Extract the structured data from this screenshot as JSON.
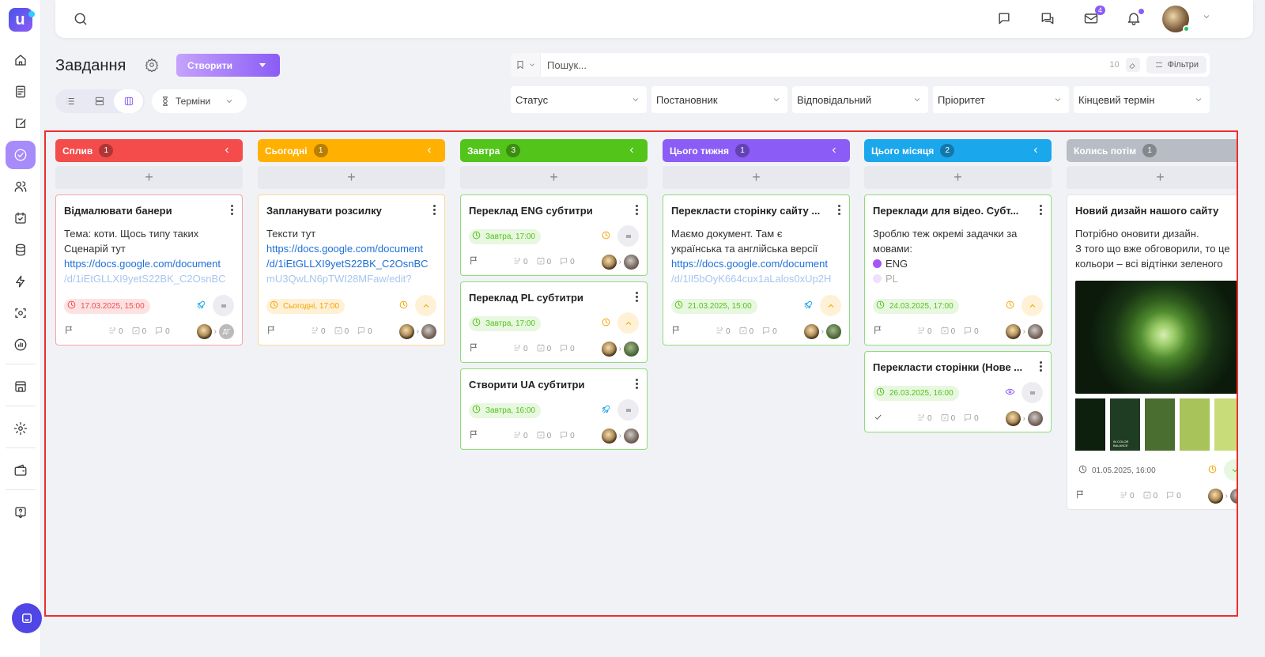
{
  "topbar": {
    "messages_badge": "4"
  },
  "page": {
    "title": "Завдання",
    "create_label": "Створити"
  },
  "view": {
    "terms_label": "Терміни"
  },
  "search": {
    "placeholder": "Пошук...",
    "count": "10",
    "filters_label": "Фільтри"
  },
  "filters": [
    "Статус",
    "Постановник",
    "Відповідальний",
    "Пріоритет",
    "Кінцевий термін"
  ],
  "colors": {
    "accent": "#8b5cf6",
    "overdue": "#f44b4b",
    "today": "#ffb000",
    "tomorrow": "#52c41a",
    "this_week": "#8b5cf6",
    "this_month": "#1aa7ec",
    "later": "#b8bcc4"
  },
  "columns": [
    {
      "title": "Сплив",
      "count": "1",
      "cards": [
        {
          "title": "Відмалювати банери",
          "desc": [
            "Тема: коти. Щось типу таких",
            "Сценарій тут"
          ],
          "link": "https://docs.google.com/document",
          "link_fade": "/d/1iEtGLLXI9yetS22BK_C2OsnBC",
          "due": "17.03.2025, 15:00",
          "status_icon": "rocket-icon",
          "priority": "equals-icon",
          "stats": {
            "subtasks": "0",
            "checklist": "0",
            "comments": "0"
          },
          "assignee_initials": "ДГ"
        }
      ]
    },
    {
      "title": "Сьогодні",
      "count": "1",
      "cards": [
        {
          "title": "Запланувати розсилку",
          "desc": [
            "Тексти тут"
          ],
          "link": "https://docs.google.com/document",
          "link2": "/d/1iEtGLLXI9yetS22BK_C2OsnBC",
          "link_fade": "mU3QwLN6pTWI28MFaw/edit?",
          "due": "Сьогодні, 17:00",
          "status_icon": "clock-icon",
          "priority": "chevron-up-icon",
          "stats": {
            "subtasks": "0",
            "checklist": "0",
            "comments": "0"
          }
        }
      ]
    },
    {
      "title": "Завтра",
      "count": "3",
      "cards": [
        {
          "title": "Переклад ENG субтитри",
          "due": "Завтра, 17:00",
          "status_icon": "clock-icon",
          "priority": "equals-icon",
          "stats": {
            "subtasks": "0",
            "checklist": "0",
            "comments": "0"
          }
        },
        {
          "title": "Переклад PL субтитри",
          "due": "Завтра, 17:00",
          "status_icon": "clock-icon",
          "priority": "chevron-up-icon",
          "stats": {
            "subtasks": "0",
            "checklist": "0",
            "comments": "0"
          }
        },
        {
          "title": "Створити UA субтитри",
          "due": "Завтра, 16:00",
          "status_icon": "rocket-icon",
          "priority": "equals-icon",
          "stats": {
            "subtasks": "0",
            "checklist": "0",
            "comments": "0"
          }
        }
      ]
    },
    {
      "title": "Цього тижня",
      "count": "1",
      "cards": [
        {
          "title": "Перекласти сторінку сайту ...",
          "desc": [
            "Маємо документ. Там є",
            "українська та англійська версії"
          ],
          "link": "https://docs.google.com/document",
          "link_fade": "/d/1lI5bOyK664cux1aLalos0xUp2H",
          "due": "21.03.2025, 15:00",
          "status_icon": "rocket-icon",
          "priority": "chevron-up-icon",
          "stats": {
            "subtasks": "0",
            "checklist": "0",
            "comments": "0"
          }
        }
      ]
    },
    {
      "title": "Цього місяця",
      "count": "2",
      "cards": [
        {
          "title": "Переклади для відео. Субт...",
          "desc": [
            "Зроблю теж окремі задачки за",
            "мовами:"
          ],
          "langs": [
            "ENG",
            "PL"
          ],
          "due": "24.03.2025, 17:00",
          "status_icon": "clock-icon",
          "priority": "chevron-up-icon",
          "stats": {
            "subtasks": "0",
            "checklist": "0",
            "comments": "0"
          }
        },
        {
          "title": "Перекласти сторінки (Нове ...",
          "due": "26.03.2025, 16:00",
          "status_icon": "eye-icon",
          "priority": "equals-icon",
          "stats": {
            "subtasks": "0",
            "checklist": "0",
            "comments": "0"
          }
        }
      ]
    },
    {
      "title": "Колись потім",
      "count": "1",
      "cards": [
        {
          "title": "Новий дизайн нашого сайту",
          "desc": [
            "Потрібно оновити дизайн.",
            "З того що вже обговорили, то це",
            "кольори – всі відтінки зеленого"
          ],
          "image": "succulent-plant-image",
          "palette": [
            "#0d1f0d",
            "#1f3d22",
            "#4a6e30",
            "#a8c35a",
            "#c9dc7a"
          ],
          "palette_text": "IN COLOR BALANCE",
          "due": "01.05.2025, 16:00",
          "status_icon": "clock-icon",
          "priority": "chevron-down-icon",
          "stats": {
            "subtasks": "0",
            "checklist": "0",
            "comments": "0"
          }
        }
      ]
    }
  ]
}
